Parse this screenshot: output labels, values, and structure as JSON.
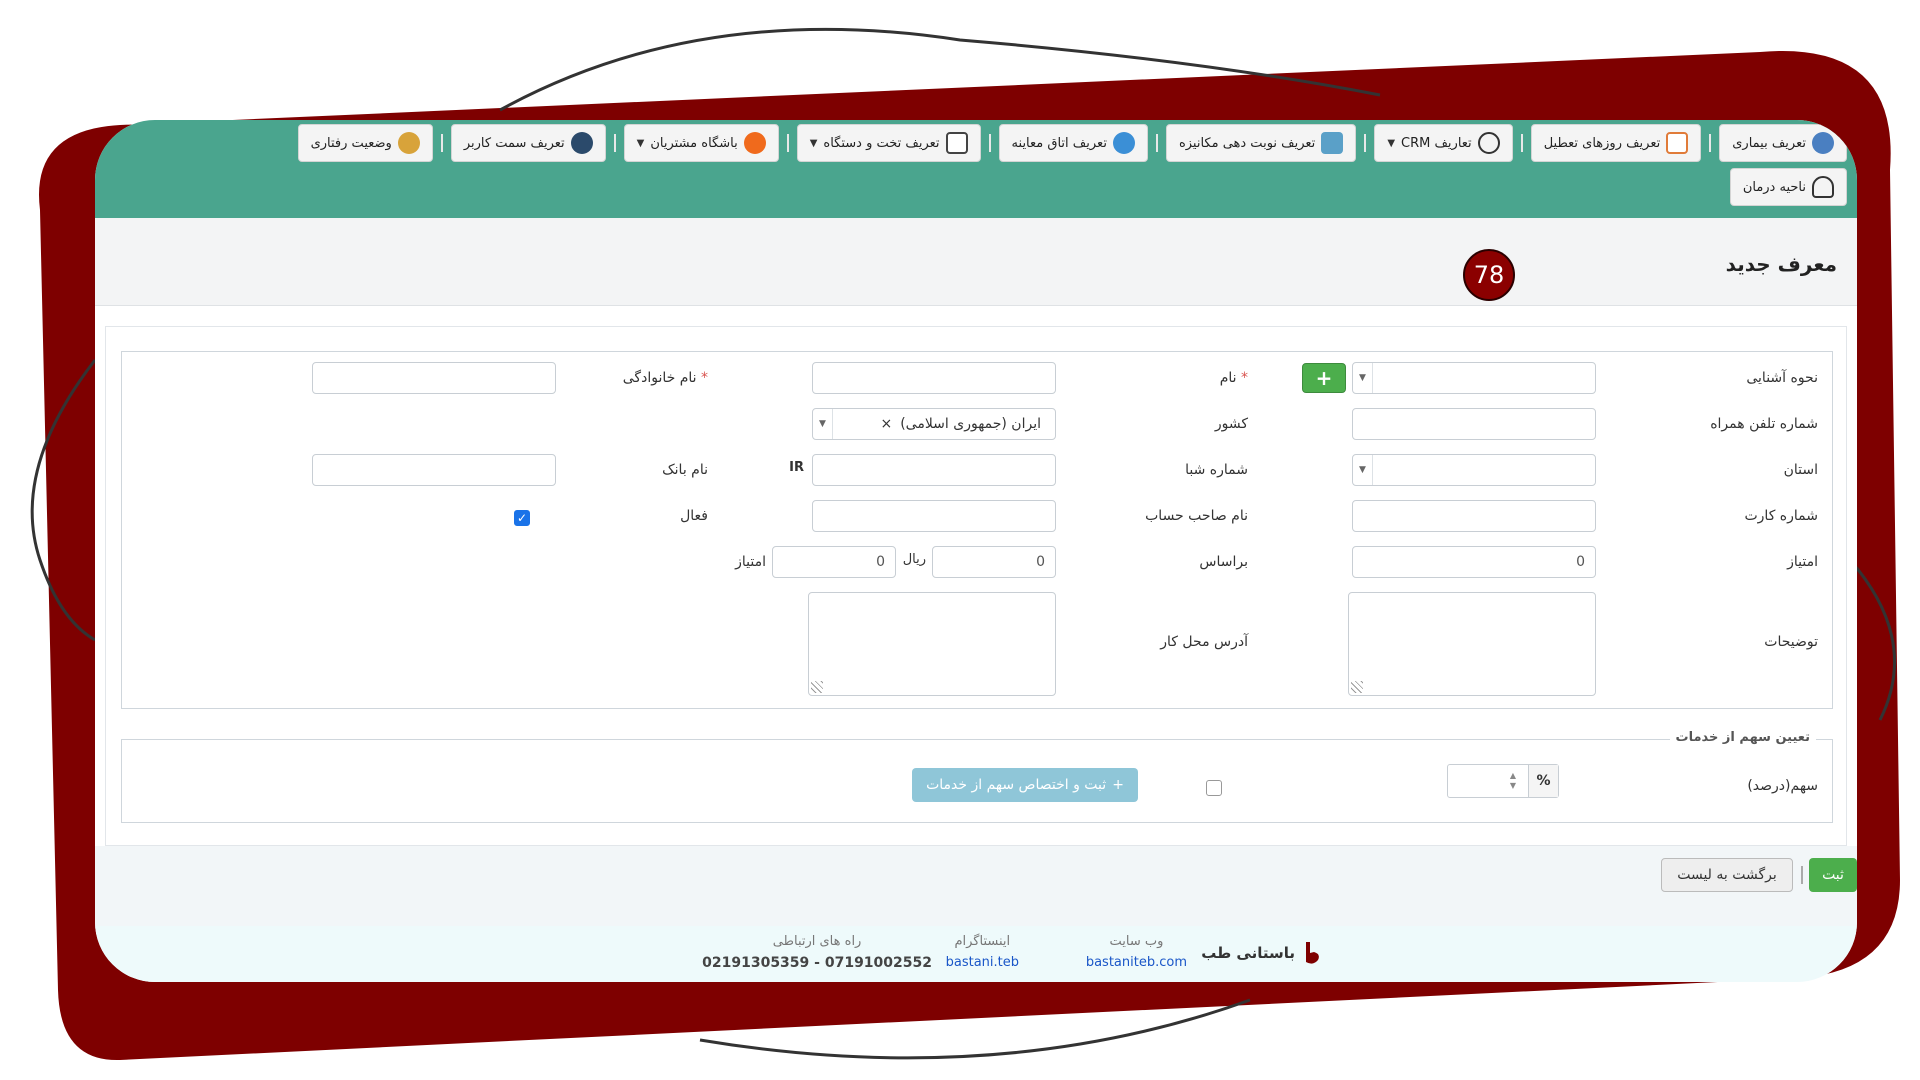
{
  "nav": {
    "row1": [
      {
        "label": "تعریف بیماری",
        "icon": "doctor-icon",
        "color": "#4a7fc1",
        "dropdown": false
      },
      {
        "label": "تعریف روزهای تعطیل",
        "icon": "calendar-icon",
        "color": "#e07b39",
        "dropdown": false
      },
      {
        "label": "تعاریف CRM",
        "icon": "crm-icon",
        "color": "#333333",
        "dropdown": true
      },
      {
        "label": "تعریف نوبت دهی مکانیزه",
        "icon": "monitor-icon",
        "color": "#5aa0c8",
        "dropdown": false
      },
      {
        "label": "تعریف اتاق معاینه",
        "icon": "clinic-room-icon",
        "color": "#3b8fd6",
        "dropdown": false
      },
      {
        "label": "تعریف تخت و دستگاه",
        "icon": "clipboard-icon",
        "color": "#444444",
        "dropdown": true
      },
      {
        "label": "باشگاه مشتریان",
        "icon": "group-icon",
        "color": "#f06a1c",
        "dropdown": true
      },
      {
        "label": "تعریف سمت کاربر",
        "icon": "user-role-icon",
        "color": "#2b4a6b",
        "dropdown": false
      },
      {
        "label": "وضعیت رفتاری",
        "icon": "head-behavior-icon",
        "color": "#d8a33a",
        "dropdown": false
      }
    ],
    "row2": [
      {
        "label": "ناحیه درمان",
        "icon": "body-figure-icon",
        "color": "#333333",
        "dropdown": false
      }
    ]
  },
  "header": {
    "title": "معرف جدید",
    "badge": "78"
  },
  "form": {
    "labels": {
      "acquaintance": "نحوه آشنایی",
      "name": "نام",
      "family": "نام خانوادگی",
      "mobile": "شماره تلفن همراه",
      "country": "کشور",
      "province": "استان",
      "sheba": "شماره شبا",
      "bank": "نام بانک",
      "card": "شماره کارت",
      "holder": "نام صاحب حساب",
      "active": "فعال",
      "score": "امتیاز",
      "basis": "براساس",
      "rial": "ریال",
      "score2": "امتیاز",
      "notes": "توضیحات",
      "workaddr": "آدرس محل کار",
      "required_mark": "*",
      "ir_prefix": "IR"
    },
    "values": {
      "country": "ایران (جمهوری اسلامی)",
      "country_clear": "×",
      "score": "0",
      "basis": "0",
      "score2": "0",
      "active_checked": true,
      "add_label": "+"
    }
  },
  "share": {
    "legend": "تعیین سهم از خدمات",
    "label": "سهم(درصد)",
    "percent_sign": "%",
    "button": "ثبت و اختصاص سهم از خدمات",
    "button_icon": "+"
  },
  "actions": {
    "save": "ثبت",
    "back": "برگشت به لیست"
  },
  "footer": {
    "brand": "باستانی طب",
    "website_label": "وب سایت",
    "website": "bastaniteb.com",
    "instagram_label": "اینستاگرام",
    "instagram": "bastani.teb",
    "contact_label": "راه های ارتباطی",
    "contact": "07191002552 - 02191305359"
  },
  "colors": {
    "nav_bg": "#4aa58e",
    "badge": "#8b0000",
    "frame": "#7e0000",
    "primary": "#4cae4c",
    "share_btn": "#8fc6d8"
  }
}
